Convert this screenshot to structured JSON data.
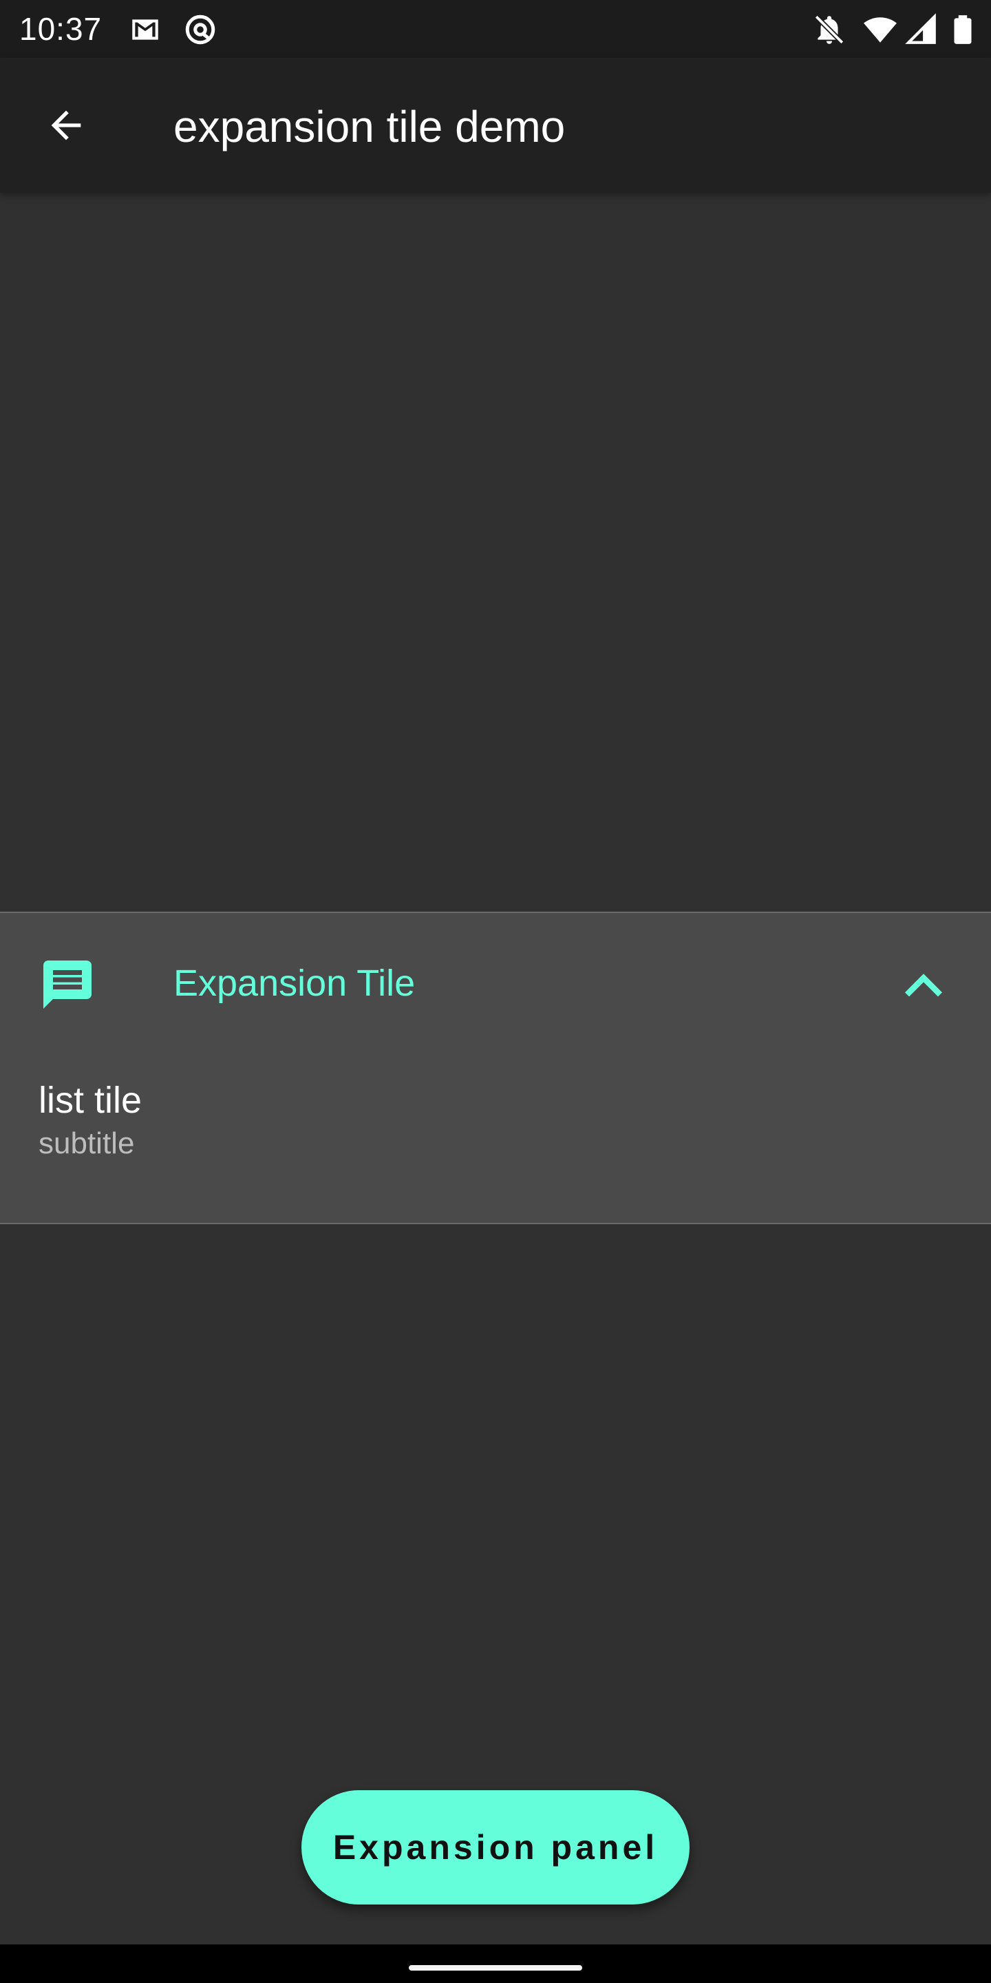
{
  "status_bar": {
    "time": "10:37",
    "icons": [
      "gmail-icon",
      "at-sign-icon",
      "notifications-off-icon",
      "wifi-icon",
      "signal-icon",
      "battery-icon"
    ]
  },
  "app_bar": {
    "back_icon": "arrow-back-icon",
    "title": "expansion tile demo"
  },
  "expansion_tile": {
    "leading_icon": "message-icon",
    "title": "Expansion Tile",
    "trailing_icon": "chevron-up-icon",
    "expanded": true,
    "children": [
      {
        "title": "list tile",
        "subtitle": "subtitle"
      }
    ]
  },
  "button": {
    "label": "Expansion panel"
  },
  "colors": {
    "accent": "#64ffda",
    "background": "#303030",
    "app_bar": "#212121",
    "status_bar": "#1c1c1c",
    "tile_background": "#4a4a4a"
  }
}
